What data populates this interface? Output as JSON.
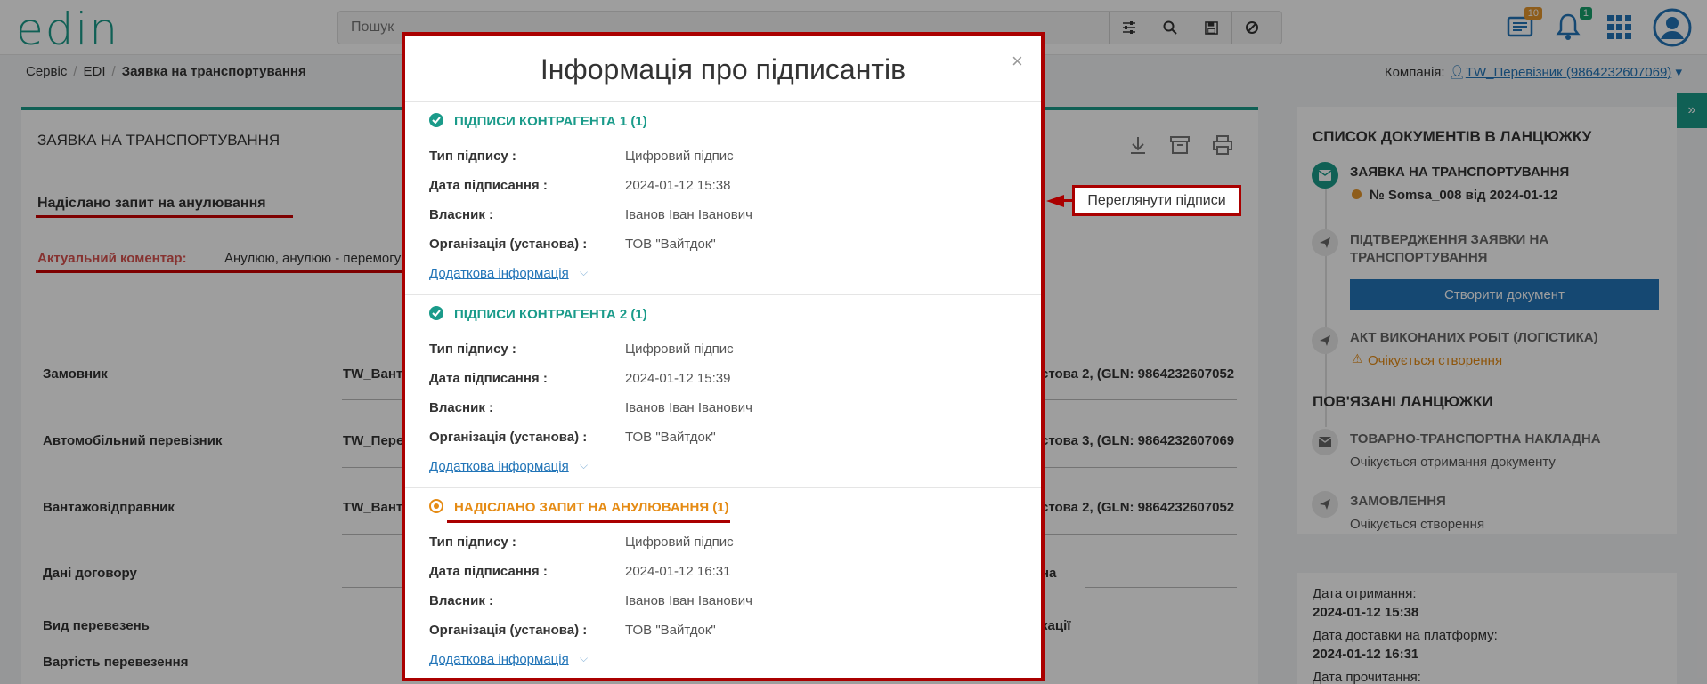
{
  "brand": {
    "logo": "edin"
  },
  "search": {
    "placeholder": "Пошук"
  },
  "header": {
    "docs_badge": "10",
    "notif_badge": "1"
  },
  "breadcrumb": {
    "items": [
      "Сервіс",
      "EDI"
    ],
    "current": "Заявка на транспортування"
  },
  "company": {
    "label": "Компанія:",
    "value": "TW_Перевізник (9864232607069)"
  },
  "main": {
    "title": "ЗАЯВКА НА ТРАНСПОРТУВАННЯ",
    "cancel_status": "Надіслано запит на анулювання",
    "comment_label": "Актуальний коментар:",
    "comment_value": "Анулюю, анулюю - перемогу",
    "view_signatures": "Переглянути підписи",
    "rows": [
      {
        "label": "Замовник",
        "value": "TW_Вант",
        "right": "стова 2, (GLN: 9864232607052"
      },
      {
        "label": "Автомобільний перевізник",
        "value": "TW_Пере",
        "right": "стова 3, (GLN: 9864232607069"
      },
      {
        "label": "Вантажовідправник",
        "value": "TW_Вант",
        "right": "стова 2, (GLN: 9864232607052"
      },
      {
        "label": "Дані договору",
        "value": "",
        "right": "на"
      },
      {
        "label": "Вид перевезень",
        "value": "",
        "right": "кації"
      },
      {
        "label": "Вартість перевезення",
        "value": "",
        "right": ""
      }
    ]
  },
  "chain": {
    "title": "СПИСОК ДОКУМЕНТІВ В ЛАНЦЮЖКУ",
    "items": [
      {
        "title": "ЗАЯВКА НА ТРАНСПОРТУВАННЯ",
        "sub": "№ Somsa_008 від 2024-01-12"
      },
      {
        "title": "ПІДТВЕРДЖЕННЯ ЗАЯВКИ НА ТРАНСПОРТУВАННЯ",
        "action": "Створити документ"
      },
      {
        "title": "АКТ ВИКОНАНИХ РОБІТ (ЛОГІСТИКА)",
        "sub": "Очікується створення"
      }
    ],
    "linked_title": "ПОВ'ЯЗАНІ ЛАНЦЮЖКИ",
    "linked": [
      {
        "title": "ТОВАРНО-ТРАНСПОРТНА НАКЛАДНА",
        "sub": "Очікується отримання документу"
      },
      {
        "title": "ЗАМОВЛЕННЯ",
        "sub": "Очікується створення"
      }
    ]
  },
  "dates": {
    "received_label": "Дата отримання:",
    "received": "2024-01-12 15:38",
    "delivered_label": "Дата доставки на платформу:",
    "delivered": "2024-01-12 16:31",
    "read_label": "Дата прочитання:"
  },
  "modal": {
    "title": "Інформація про підписантів",
    "close": "×",
    "labels": {
      "type": "Тип підпису :",
      "date": "Дата підписання :",
      "owner": "Власник :",
      "org": "Організація (установа) :",
      "more": "Додаткова інформація"
    },
    "sections": [
      {
        "title": "ПІДПИСИ КОНТРАГЕНТА 1 (1)",
        "type": "Цифровий підпис",
        "date": "2024-01-12 15:38",
        "owner": "Іванов Іван Іванович",
        "org": "ТОВ \"Вайтдок\""
      },
      {
        "title": "ПІДПИСИ КОНТРАГЕНТА 2 (1)",
        "type": "Цифровий підпис",
        "date": "2024-01-12 15:39",
        "owner": "Іванов Іван Іванович",
        "org": "ТОВ \"Вайтдок\""
      },
      {
        "title": "НАДІСЛАНО ЗАПИТ НА АНУЛЮВАННЯ (1)",
        "type": "Цифровий підпис",
        "date": "2024-01-12 16:31",
        "owner": "Іванов Іван Іванович",
        "org": "ТОВ \"Вайтдок\""
      }
    ]
  },
  "colors": {
    "accent": "#1a9b8a",
    "link": "#2275b8",
    "highlight": "#aa0000",
    "warning": "#e58b14"
  }
}
